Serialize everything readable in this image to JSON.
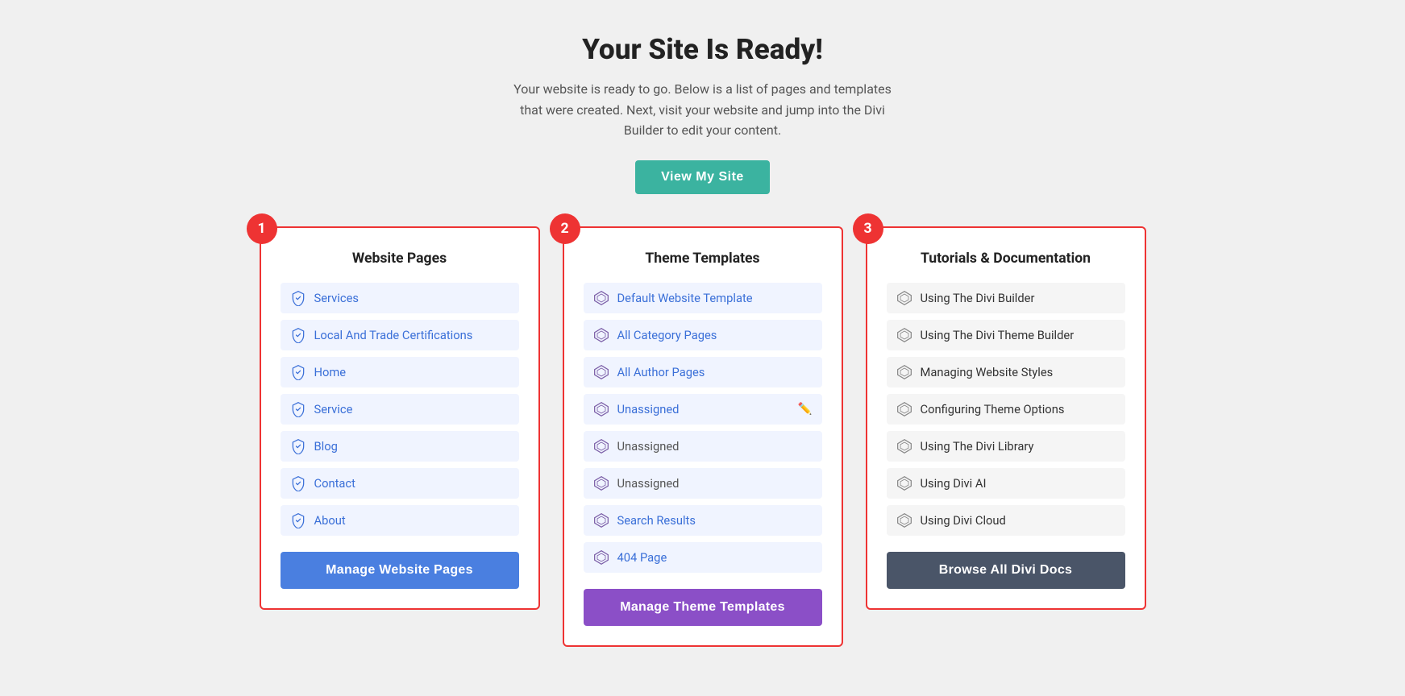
{
  "header": {
    "title": "Your Site Is Ready!",
    "description": "Your website is ready to go. Below is a list of pages and templates that were created. Next, visit your website and jump into the Divi Builder to edit your content.",
    "view_site_btn": "View My Site"
  },
  "columns": [
    {
      "step": "1",
      "title": "Website Pages",
      "items": [
        {
          "label": "Services",
          "link": true
        },
        {
          "label": "Local And Trade Certifications",
          "link": true
        },
        {
          "label": "Home",
          "link": true
        },
        {
          "label": "Service",
          "link": true
        },
        {
          "label": "Blog",
          "link": true
        },
        {
          "label": "Contact",
          "link": true
        },
        {
          "label": "About",
          "link": true
        }
      ],
      "button": "Manage Website Pages",
      "btn_class": "btn-blue"
    },
    {
      "step": "2",
      "title": "Theme Templates",
      "items": [
        {
          "label": "Default Website Template",
          "link": true
        },
        {
          "label": "All Category Pages",
          "link": true
        },
        {
          "label": "All Author Pages",
          "link": true
        },
        {
          "label": "Unassigned",
          "link": true,
          "edit": true
        },
        {
          "label": "Unassigned",
          "link": false
        },
        {
          "label": "Unassigned",
          "link": false
        },
        {
          "label": "Search Results",
          "link": true
        },
        {
          "label": "404 Page",
          "link": true
        }
      ],
      "button": "Manage Theme Templates",
      "btn_class": "btn-purple"
    },
    {
      "step": "3",
      "title": "Tutorials & Documentation",
      "items": [
        {
          "label": "Using The Divi Builder",
          "link": true
        },
        {
          "label": "Using The Divi Theme Builder",
          "link": true
        },
        {
          "label": "Managing Website Styles",
          "link": true
        },
        {
          "label": "Configuring Theme Options",
          "link": true
        },
        {
          "label": "Using The Divi Library",
          "link": true
        },
        {
          "label": "Using Divi AI",
          "link": true
        },
        {
          "label": "Using Divi Cloud",
          "link": true
        }
      ],
      "button": "Browse All Divi Docs",
      "btn_class": "btn-dark"
    }
  ]
}
